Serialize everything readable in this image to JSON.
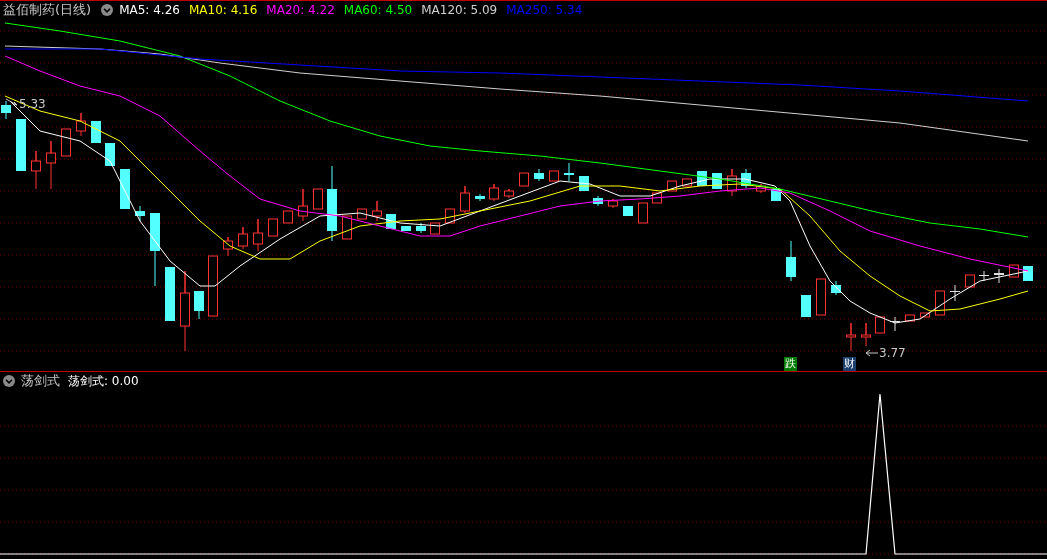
{
  "main_panel": {
    "title": "益佰制药(日线)",
    "indicators": [
      {
        "label": "MA5: 4.26",
        "color": "#ffffff"
      },
      {
        "label": "MA10: 4.16",
        "color": "#ffff00"
      },
      {
        "label": "MA20: 4.22",
        "color": "#ff00ff"
      },
      {
        "label": "MA60: 4.50",
        "color": "#00ff00"
      },
      {
        "label": "MA120: 5.09",
        "color": "#d0d0d0"
      },
      {
        "label": "MA250: 5.34",
        "color": "#0000ff"
      }
    ],
    "high_label": "5.33",
    "low_label": "3.77",
    "markers": [
      {
        "text": "跌",
        "color": "#007a00"
      },
      {
        "text": "财",
        "color": "#1c3f6e"
      }
    ]
  },
  "sub_panel": {
    "title": "荡剑式",
    "indicators": [
      {
        "label": "荡剑式: 0.00",
        "color": "#ffffff"
      }
    ]
  }
}
